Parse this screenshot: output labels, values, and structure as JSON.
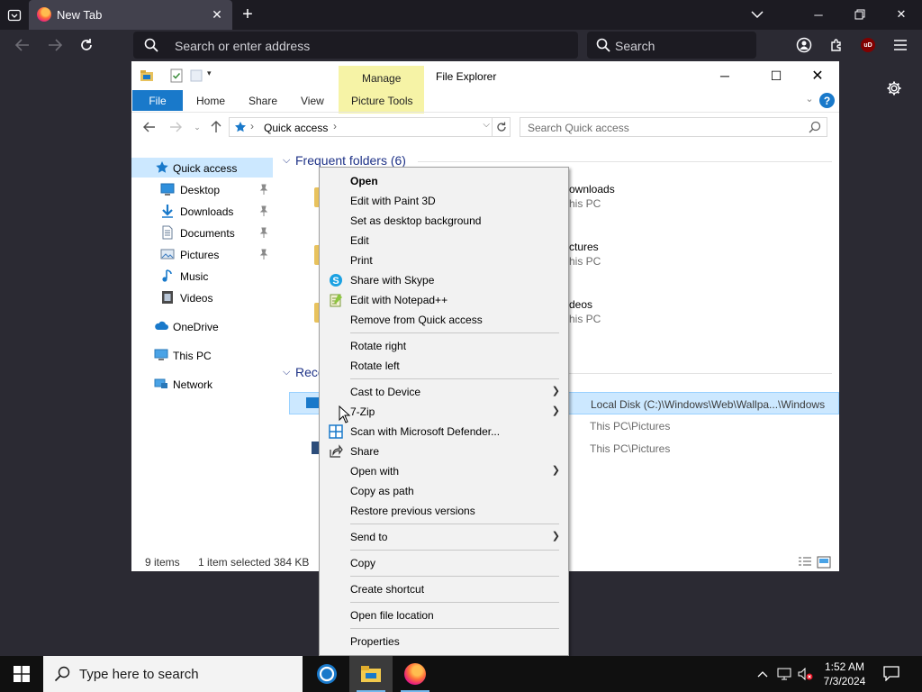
{
  "browser": {
    "tab_title": "New Tab",
    "url_placeholder": "Search or enter address",
    "search_placeholder": "Search"
  },
  "explorer": {
    "title": "File Explorer",
    "contextual_tab": "Manage",
    "ribbon_tabs": [
      "File",
      "Home",
      "Share",
      "View",
      "Picture Tools"
    ],
    "address": "Quick access",
    "search_placeholder": "Search Quick access",
    "nav": [
      {
        "label": "Quick access",
        "icon": "star-icon",
        "pinned": false
      },
      {
        "label": "Desktop",
        "icon": "desktop-icon",
        "pinned": true
      },
      {
        "label": "Downloads",
        "icon": "download-icon",
        "pinned": true
      },
      {
        "label": "Documents",
        "icon": "document-icon",
        "pinned": true
      },
      {
        "label": "Pictures",
        "icon": "pictures-icon",
        "pinned": true
      },
      {
        "label": "Music",
        "icon": "music-icon",
        "pinned": false
      },
      {
        "label": "Videos",
        "icon": "video-icon",
        "pinned": false
      },
      {
        "label": "OneDrive",
        "icon": "cloud-icon",
        "pinned": false
      },
      {
        "label": "This PC",
        "icon": "computer-icon",
        "pinned": false
      },
      {
        "label": "Network",
        "icon": "network-icon",
        "pinned": false
      }
    ],
    "frequent_header": "Frequent folders (6)",
    "recent_header": "Rece",
    "tiles": [
      {
        "name": "ownloads",
        "sub": "his PC"
      },
      {
        "name": "ctures",
        "sub": "his PC"
      },
      {
        "name": "deos",
        "sub": "his PC"
      }
    ],
    "recent_locations": [
      "Local Disk (C:)\\Windows\\Web\\Wallpa...\\Windows",
      "This PC\\Pictures",
      "This PC\\Pictures"
    ],
    "status": {
      "items": "9 items",
      "selected": "1 item selected",
      "size": "384 KB"
    }
  },
  "context_menu": {
    "groups": [
      [
        {
          "label": "Open",
          "bold": true
        },
        {
          "label": "Edit with Paint 3D"
        },
        {
          "label": "Set as desktop background"
        },
        {
          "label": "Edit"
        },
        {
          "label": "Print"
        },
        {
          "label": "Share with Skype",
          "icon": "skype-icon"
        },
        {
          "label": "Edit with Notepad++",
          "icon": "notepadpp-icon"
        },
        {
          "label": "Remove from Quick access"
        }
      ],
      [
        {
          "label": "Rotate right"
        },
        {
          "label": "Rotate left"
        }
      ],
      [
        {
          "label": "Cast to Device",
          "submenu": true
        },
        {
          "label": "7-Zip",
          "submenu": true
        },
        {
          "label": "Scan with Microsoft Defender...",
          "icon": "defender-icon"
        },
        {
          "label": "Share",
          "icon": "share-icon"
        },
        {
          "label": "Open with",
          "submenu": true
        },
        {
          "label": "Copy as path"
        },
        {
          "label": "Restore previous versions"
        }
      ],
      [
        {
          "label": "Send to",
          "submenu": true
        }
      ],
      [
        {
          "label": "Copy"
        }
      ],
      [
        {
          "label": "Create shortcut"
        }
      ],
      [
        {
          "label": "Open file location"
        }
      ],
      [
        {
          "label": "Properties"
        }
      ]
    ]
  },
  "taskbar": {
    "search_placeholder": "Type here to search",
    "time": "1:52 AM",
    "date": "7/3/2024"
  },
  "colors": {
    "accent": "#1979ca",
    "selection": "#cce8ff",
    "manage_tab": "#f6f3a6",
    "browser_bg": "#2b2a33"
  }
}
